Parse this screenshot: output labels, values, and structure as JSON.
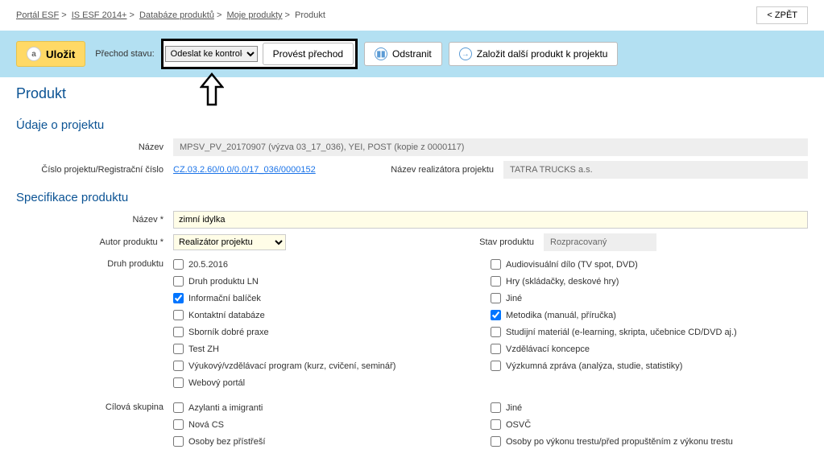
{
  "breadcrumb": {
    "items": [
      "Portál ESF",
      "IS ESF 2014+",
      "Databáze produktů",
      "Moje produkty"
    ],
    "current": "Produkt"
  },
  "back_button": "< ZPĚT",
  "actionbar": {
    "save": "Uložit",
    "state_label": "Přechod stavu:",
    "state_selected": "Odeslat ke kontrole",
    "transition": "Provést přechod",
    "remove": "Odstranit",
    "create_another": "Založit další produkt k projektu"
  },
  "page_title": "Produkt",
  "project_section": {
    "title": "Údaje o projektu",
    "name_label": "Název",
    "name_value": "MPSV_PV_20170907 (výzva 03_17_036), YEI, POST (kopie z 0000117)",
    "regnum_label": "Číslo projektu/Registrační číslo",
    "regnum_value": "CZ.03.2.60/0.0/0.0/17_036/0000152",
    "realizer_label": "Název realizátora projektu",
    "realizer_value": "TATRA TRUCKS a.s."
  },
  "spec_section": {
    "title": "Specifikace produktu",
    "name_label": "Název *",
    "name_value": "zimní idylka",
    "author_label": "Autor produktu *",
    "author_value": "Realizátor projektu",
    "state_label": "Stav produktu",
    "state_value": "Rozpracovaný",
    "type_label": "Druh produktu",
    "types": {
      "left": [
        {
          "checked": false,
          "label": "20.5.2016"
        },
        {
          "checked": false,
          "label": "Druh produktu LN"
        },
        {
          "checked": true,
          "label": "Informační balíček"
        },
        {
          "checked": false,
          "label": "Kontaktní databáze"
        },
        {
          "checked": false,
          "label": "Sborník dobré praxe"
        },
        {
          "checked": false,
          "label": "Test ZH"
        },
        {
          "checked": false,
          "label": "Výukový/vzdělávací program (kurz, cvičení, seminář)"
        },
        {
          "checked": false,
          "label": "Webový portál"
        }
      ],
      "right": [
        {
          "checked": false,
          "label": "Audiovisuální dílo (TV spot, DVD)"
        },
        {
          "checked": false,
          "label": "Hry (skládačky, deskové hry)"
        },
        {
          "checked": false,
          "label": "Jiné"
        },
        {
          "checked": true,
          "label": "Metodika (manuál, příručka)"
        },
        {
          "checked": false,
          "label": "Studijní materiál (e-learning, skripta, učebnice CD/DVD aj.)"
        },
        {
          "checked": false,
          "label": "Vzdělávací koncepce"
        },
        {
          "checked": false,
          "label": "Výzkumná zpráva (analýza, studie, statistiky)"
        }
      ]
    },
    "target_label": "Cílová skupina",
    "targets": {
      "left": [
        {
          "checked": false,
          "label": "Azylanti a imigranti"
        },
        {
          "checked": false,
          "label": "Nová CS"
        },
        {
          "checked": false,
          "label": "Osoby bez přístřeší"
        }
      ],
      "right": [
        {
          "checked": false,
          "label": "Jiné"
        },
        {
          "checked": false,
          "label": "OSVČ"
        },
        {
          "checked": false,
          "label": "Osoby po výkonu trestu/před propuštěním z výkonu trestu"
        }
      ]
    }
  }
}
